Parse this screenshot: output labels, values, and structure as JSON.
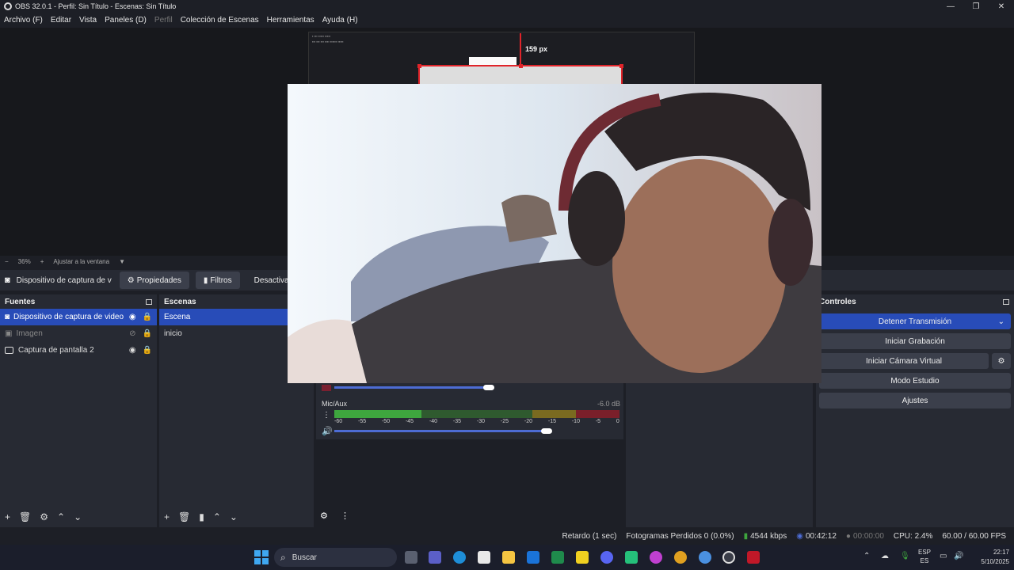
{
  "window": {
    "title": "OBS 32.0.1 - Perfil: Sin Título - Escenas: Sin Título"
  },
  "menu": [
    "Archivo (F)",
    "Editar",
    "Vista",
    "Paneles (D)",
    "Perfil",
    "Colección de Escenas",
    "Herramientas",
    "Ayuda (H)"
  ],
  "preview": {
    "measure_label": "159 px"
  },
  "zoom": {
    "minus": "−",
    "value": "36%",
    "plus": "+",
    "fit": "Ajustar a la ventana"
  },
  "sourcebar": {
    "source_name": "Dispositivo de captura de v",
    "properties": "Propiedades",
    "filters": "Filtros",
    "deactivate": "Desactivar"
  },
  "sources": {
    "title": "Fuentes",
    "items": [
      {
        "label": "Dispositivo de captura de video",
        "selected": true
      },
      {
        "label": "Imagen",
        "hidden": true
      },
      {
        "label": "Captura de pantalla 2"
      }
    ]
  },
  "scenes": {
    "title": "Escenas",
    "items": [
      "Escena",
      "inicio"
    ]
  },
  "mixer": {
    "mic_name": "Mic/Aux",
    "mic_db": "-6.0 dB",
    "ticks": [
      "-60",
      "-55",
      "-50",
      "-45",
      "-40",
      "-35",
      "-30",
      "-25",
      "-20",
      "-15",
      "-10",
      "-5",
      "0"
    ]
  },
  "controls": {
    "title": "Controles",
    "stop_stream": "Detener Transmisión",
    "start_recording": "Iniciar Grabación",
    "start_virtual_cam": "Iniciar Cámara Virtual",
    "studio_mode": "Modo Estudio",
    "settings": "Ajustes"
  },
  "status": {
    "delay": "Retardo (1 sec)",
    "dropped": "Fotogramas Perdidos 0 (0.0%)",
    "bitrate": "4544 kbps",
    "stream_time": "00:42:12",
    "rec_time": "00:00:00",
    "cpu": "CPU: 2.4%",
    "fps": "60.00 / 60.00 FPS"
  },
  "taskbar": {
    "search": "Buscar",
    "lang_top": "ESP",
    "lang_bottom": "ES",
    "time": "22:17",
    "date": "5/10/2025"
  },
  "colors": {
    "accent": "#284cb8",
    "red": "#e0242a",
    "panel": "#272a33",
    "bg": "#1d1f26"
  }
}
